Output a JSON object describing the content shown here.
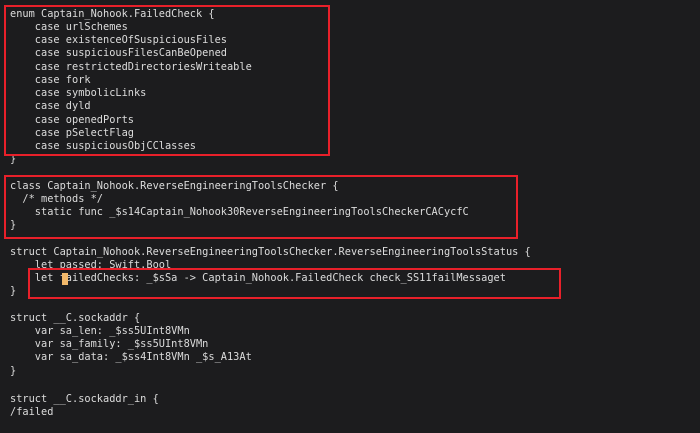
{
  "terminal": {
    "lines": [
      "enum Captain_Nohook.FailedCheck {",
      "    case urlSchemes",
      "    case existenceOfSuspiciousFiles",
      "    case suspiciousFilesCanBeOpened",
      "    case restrictedDirectoriesWriteable",
      "    case fork",
      "    case symbolicLinks",
      "    case dyld",
      "    case openedPorts",
      "    case pSelectFlag",
      "    case suspiciousObjCClasses",
      "}",
      "",
      "class Captain_Nohook.ReverseEngineeringToolsChecker {",
      "  /* methods */",
      "    static func _$s14Captain_Nohook30ReverseEngineeringToolsCheckerCACycfC",
      "}",
      "",
      "struct Captain_Nohook.ReverseEngineeringToolsChecker.ReverseEngineeringToolsStatus {",
      "    let passed: Swift.Bool",
      "    let failedChecks: _$sSa -> Captain_Nohook.FailedCheck check_SS11failMessaget",
      "}",
      "",
      "struct __C.sockaddr {",
      "    var sa_len: _$ss5UInt8VMn",
      "    var sa_family: _$ss5UInt8VMn",
      "    var sa_data: _$ss4Int8VMn _$s_A13At",
      "}",
      "",
      "struct __C.sockaddr_in {",
      "/failed"
    ]
  },
  "colors": {
    "background": "#1c1c1e",
    "text": "#dcdcdc",
    "highlight_box": "#e8202a",
    "cursor": "#f2b86a"
  }
}
